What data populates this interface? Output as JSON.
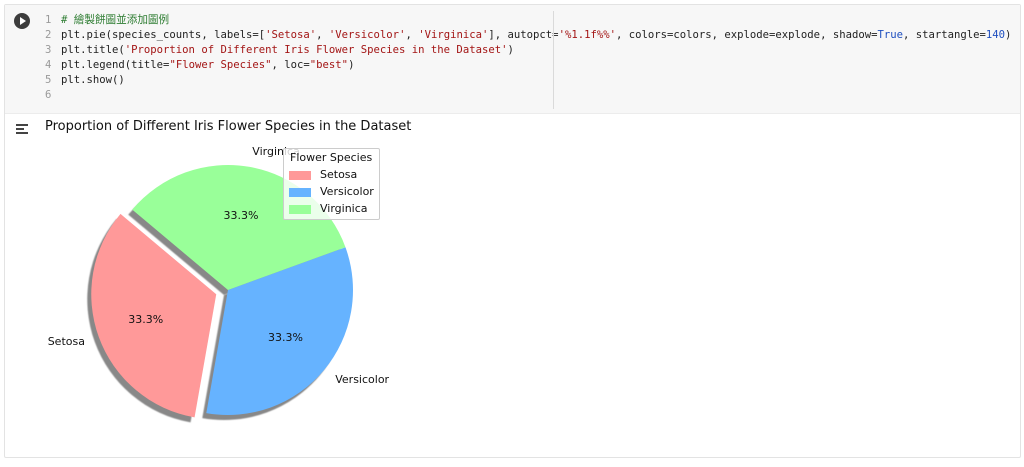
{
  "code": {
    "lines": [
      {
        "num": "1",
        "parts": [
          {
            "t": "# 繪製餅圖並添加圖例",
            "c": "cm"
          }
        ]
      },
      {
        "num": "2",
        "parts": [
          {
            "t": "plt.pie(species_counts, labels=[",
            "c": ""
          },
          {
            "t": "'Setosa'",
            "c": "st"
          },
          {
            "t": ", ",
            "c": ""
          },
          {
            "t": "'Versicolor'",
            "c": "st"
          },
          {
            "t": ", ",
            "c": ""
          },
          {
            "t": "'Virginica'",
            "c": "st"
          },
          {
            "t": "], autopct=",
            "c": ""
          },
          {
            "t": "'%1.1f%%'",
            "c": "st"
          },
          {
            "t": ", colors=colors, explode=explode, shadow=",
            "c": ""
          },
          {
            "t": "True",
            "c": "kw"
          },
          {
            "t": ", startangle=",
            "c": ""
          },
          {
            "t": "140",
            "c": "kw"
          },
          {
            "t": ")",
            "c": ""
          }
        ]
      },
      {
        "num": "3",
        "parts": [
          {
            "t": "plt.title(",
            "c": ""
          },
          {
            "t": "'Proportion of Different Iris Flower Species in the Dataset'",
            "c": "st"
          },
          {
            "t": ")",
            "c": ""
          }
        ]
      },
      {
        "num": "4",
        "parts": [
          {
            "t": "plt.legend(title=",
            "c": ""
          },
          {
            "t": "\"Flower Species\"",
            "c": "st"
          },
          {
            "t": ", loc=",
            "c": ""
          },
          {
            "t": "\"best\"",
            "c": "st"
          },
          {
            "t": ")",
            "c": ""
          }
        ]
      },
      {
        "num": "5",
        "parts": [
          {
            "t": "plt.show()",
            "c": ""
          }
        ]
      },
      {
        "num": "6",
        "parts": []
      }
    ]
  },
  "chart_data": {
    "type": "pie",
    "title": "Proportion of Different Iris Flower Species in the Dataset",
    "categories": [
      "Setosa",
      "Versicolor",
      "Virginica"
    ],
    "values": [
      33.3,
      33.3,
      33.3
    ],
    "pct_labels": [
      "33.3%",
      "33.3%",
      "33.3%"
    ],
    "colors": [
      "#ff9999",
      "#66b3ff",
      "#99ff99"
    ],
    "explode": [
      0.1,
      0,
      0
    ],
    "startangle": 140,
    "shadow": true,
    "legend": {
      "title": "Flower Species",
      "placement": "best",
      "entries": [
        "Setosa",
        "Versicolor",
        "Virginica"
      ]
    }
  }
}
